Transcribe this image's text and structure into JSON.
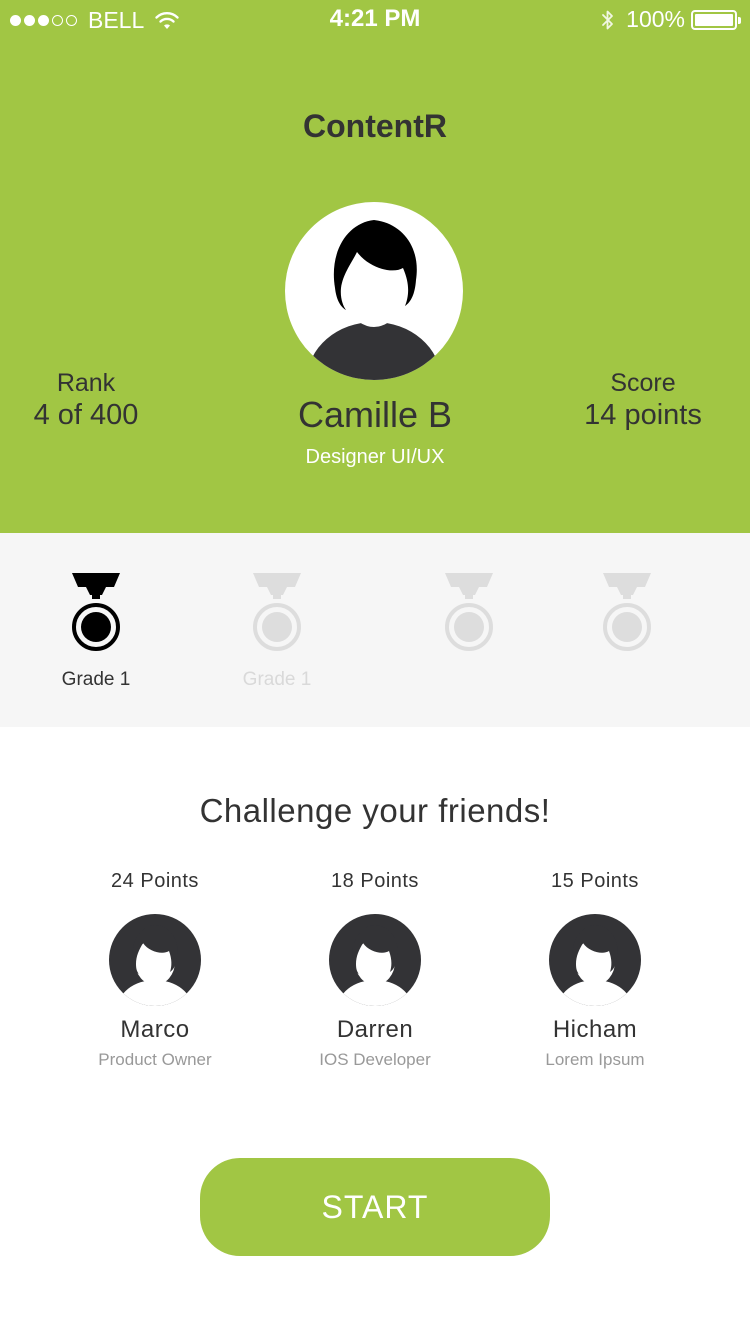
{
  "status_bar": {
    "carrier": "BELL",
    "time": "4:21 PM",
    "battery": "100%",
    "signal_strength": 3,
    "signal_max": 5
  },
  "app": {
    "title": "ContentR",
    "accent_color": "#a1c644"
  },
  "profile": {
    "name": "Camille B",
    "role": "Designer UI/UX",
    "rank_label": "Rank",
    "rank_value": "4 of 400",
    "score_label": "Score",
    "score_value": "14 points"
  },
  "grades": [
    {
      "label": "Grade 1",
      "state": "active",
      "icon": "medal-icon"
    },
    {
      "label": "Grade 1",
      "state": "locked",
      "icon": "medal-icon"
    },
    {
      "label": "",
      "state": "locked",
      "icon": "medal-icon"
    },
    {
      "label": "",
      "state": "locked",
      "icon": "medal-icon"
    }
  ],
  "challenge": {
    "title": "Challenge your friends!",
    "friends": [
      {
        "points": "24 Points",
        "name": "Marco",
        "role": "Product Owner"
      },
      {
        "points": "18 Points",
        "name": "Darren",
        "role": "IOS Developer"
      },
      {
        "points": "15 Points",
        "name": "Hicham",
        "role": "Lorem Ipsum"
      }
    ]
  },
  "start_button": {
    "label": "START"
  }
}
